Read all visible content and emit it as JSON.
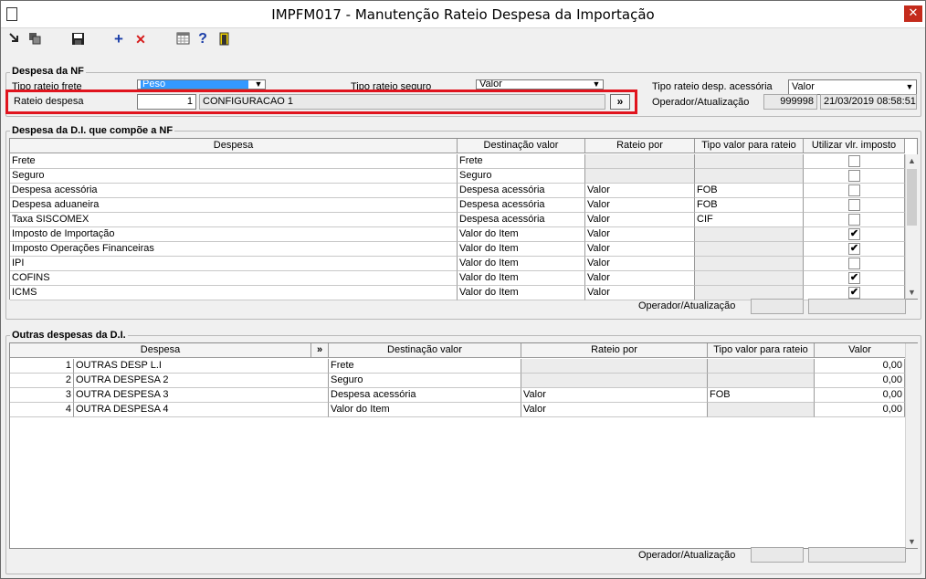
{
  "window": {
    "title": "IMPFM017 - Manutenção Rateio Despesa da Importação",
    "close": "✕"
  },
  "toolbar": {
    "add": "+",
    "delete": "✕",
    "help": "?"
  },
  "nf": {
    "group_title": "Despesa da NF",
    "frete_label": "Tipo rateio frete",
    "frete_value": "Peso",
    "seguro_label": "Tipo rateio seguro",
    "seguro_value": "Valor",
    "acessoria_label": "Tipo rateio desp. acessória",
    "acessoria_value": "Valor",
    "rateio_label": "Rateio despesa",
    "rateio_code": "1",
    "rateio_desc": "CONFIGURACAO 1",
    "rateio_btn": "»",
    "operador_label": "Operador/Atualização",
    "operador_value": "999998",
    "atualizacao_value": "21/03/2019 08:58:51"
  },
  "di": {
    "group_title": "Despesa da D.I. que compõe a NF",
    "headers": [
      "Despesa",
      "Destinação valor",
      "Rateio por",
      "Tipo valor para rateio",
      "Utilizar vlr. imposto"
    ],
    "rows": [
      {
        "despesa": "Frete",
        "destinacao": "Frete",
        "rateio": "",
        "tipo": "",
        "imposto": false
      },
      {
        "despesa": "Seguro",
        "destinacao": "Seguro",
        "rateio": "",
        "tipo": "",
        "imposto": false
      },
      {
        "despesa": "Despesa acessória",
        "destinacao": "Despesa acessória",
        "rateio": "Valor",
        "tipo": "FOB",
        "imposto": false
      },
      {
        "despesa": "Despesa aduaneira",
        "destinacao": "Despesa acessória",
        "rateio": "Valor",
        "tipo": "FOB",
        "imposto": false
      },
      {
        "despesa": "Taxa SISCOMEX",
        "destinacao": "Despesa acessória",
        "rateio": "Valor",
        "tipo": "CIF",
        "imposto": false
      },
      {
        "despesa": "Imposto de Importação",
        "destinacao": "Valor do Item",
        "rateio": "Valor",
        "tipo": "",
        "imposto": true
      },
      {
        "despesa": "Imposto Operações Financeiras",
        "destinacao": "Valor do Item",
        "rateio": "Valor",
        "tipo": "",
        "imposto": true
      },
      {
        "despesa": "IPI",
        "destinacao": "Valor do Item",
        "rateio": "Valor",
        "tipo": "",
        "imposto": false
      },
      {
        "despesa": "COFINS",
        "destinacao": "Valor do Item",
        "rateio": "Valor",
        "tipo": "",
        "imposto": true
      },
      {
        "despesa": "ICMS",
        "destinacao": "Valor do Item",
        "rateio": "Valor",
        "tipo": "",
        "imposto": true
      }
    ],
    "operador_label": "Operador/Atualização"
  },
  "outras": {
    "group_title": "Outras despesas da D.I.",
    "headers": [
      "Despesa",
      "»",
      "Destinação valor",
      "Rateio por",
      "Tipo valor para rateio",
      "Valor"
    ],
    "rows": [
      {
        "num": "1",
        "despesa": "OUTRAS DESP L.I",
        "destinacao": "Frete",
        "rateio": "",
        "tipo": "",
        "valor": "0,00"
      },
      {
        "num": "2",
        "despesa": "OUTRA DESPESA 2",
        "destinacao": "Seguro",
        "rateio": "",
        "tipo": "",
        "valor": "0,00"
      },
      {
        "num": "3",
        "despesa": "OUTRA DESPESA 3",
        "destinacao": "Despesa acessória",
        "rateio": "Valor",
        "tipo": "FOB",
        "valor": "0,00"
      },
      {
        "num": "4",
        "despesa": "OUTRA DESPESA 4",
        "destinacao": "Valor do Item",
        "rateio": "Valor",
        "tipo": "",
        "valor": "0,00"
      }
    ],
    "operador_label": "Operador/Atualização"
  },
  "colors": {
    "highlight": "#e0141e",
    "selection": "#3399ff",
    "close": "#c42b1c"
  }
}
